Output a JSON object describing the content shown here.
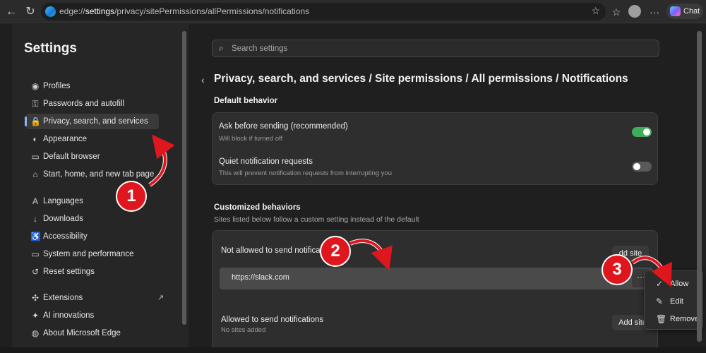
{
  "browser": {
    "url_prefix": "edge://",
    "url_host": "settings",
    "url_path": "/privacy/sitePermissions/allPermissions/notifications",
    "chat_label": "Chat",
    "icons": {
      "back": "back-arrow-icon",
      "refresh": "refresh-icon",
      "favorite": "star-icon",
      "favorites_list": "favorites-icon",
      "profile": "avatar",
      "more": "more-icon",
      "copilot": "copilot-icon"
    }
  },
  "sidebar": {
    "title": "Settings",
    "items": [
      {
        "label": "Profiles",
        "icon": "profile-icon",
        "glyph": "◉"
      },
      {
        "label": "Passwords and autofill",
        "icon": "key-icon",
        "glyph": "⚿"
      },
      {
        "label": "Privacy, search, and services",
        "icon": "lock-icon",
        "glyph": "🔒",
        "active": true
      },
      {
        "label": "Appearance",
        "icon": "palette-icon",
        "glyph": "◐"
      },
      {
        "label": "Default browser",
        "icon": "browser-icon",
        "glyph": "▭"
      },
      {
        "label": "Start, home, and new tab page",
        "icon": "home-icon",
        "glyph": "⌂"
      },
      {
        "label": "Languages",
        "icon": "languages-icon",
        "glyph": "A"
      },
      {
        "label": "Downloads",
        "icon": "download-icon",
        "glyph": "↓"
      },
      {
        "label": "Accessibility",
        "icon": "accessibility-icon",
        "glyph": "♿"
      },
      {
        "label": "System and performance",
        "icon": "laptop-icon",
        "glyph": "▭"
      },
      {
        "label": "Reset settings",
        "icon": "reset-icon",
        "glyph": "↺"
      },
      {
        "label": "Extensions",
        "icon": "puzzle-icon",
        "glyph": "✣"
      },
      {
        "label": "AI innovations",
        "icon": "ai-icon",
        "glyph": "✦"
      },
      {
        "label": "About Microsoft Edge",
        "icon": "edge-icon",
        "glyph": "◍"
      }
    ]
  },
  "main": {
    "search_placeholder": "Search settings",
    "breadcrumb": "Privacy, search, and services / Site permissions / All permissions / Notifications",
    "default_behavior": {
      "heading": "Default behavior",
      "rows": [
        {
          "title": "Ask before sending (recommended)",
          "desc": "Will block if turned off",
          "on": true
        },
        {
          "title": "Quiet notification requests",
          "desc": "This will prevent notification requests from interrupting you",
          "on": false
        }
      ]
    },
    "customized": {
      "heading": "Customized behaviors",
      "sub": "Sites listed below follow a custom setting instead of the default",
      "not_allowed_label": "Not allowed to send notifica",
      "not_allowed_button": "dd site",
      "site": "https://slack.com",
      "more_label": "···",
      "allowed_label": "Allowed to send notifications",
      "allowed_empty": "No sites added",
      "allowed_button": "Add site"
    }
  },
  "context_menu": {
    "items": [
      {
        "label": "Allow",
        "icon": "check-circle-icon",
        "glyph": "✓"
      },
      {
        "label": "Edit",
        "icon": "pencil-icon",
        "glyph": "✎"
      },
      {
        "label": "Remove",
        "icon": "trash-icon",
        "glyph": "🗑"
      }
    ]
  },
  "annotations": {
    "badges": [
      "1",
      "2",
      "3"
    ],
    "color": "#e0161e"
  }
}
